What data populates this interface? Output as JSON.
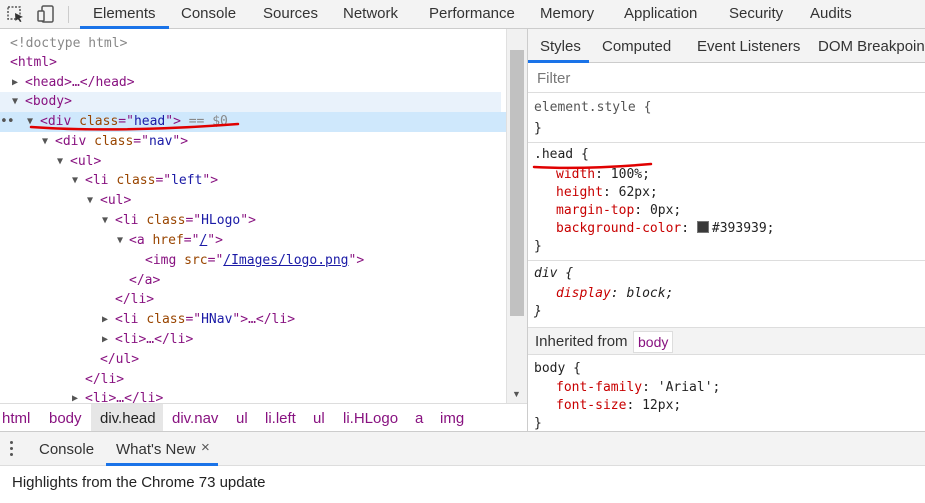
{
  "toolbar": {
    "tabs": [
      "Elements",
      "Console",
      "Sources",
      "Network",
      "Performance",
      "Memory",
      "Application",
      "Security",
      "Audits"
    ],
    "active_tab": "Elements",
    "accent_color": "#1a73e8"
  },
  "dom": {
    "doctype": "<!doctype html>",
    "html_tag": "<html>",
    "head_collapsed": "<head>…</head>",
    "body_open": "<body>",
    "selected_suffix": "== $0",
    "lines": [
      {
        "tag": "div",
        "attr": "class",
        "value": "head"
      },
      {
        "tag": "div",
        "attr": "class",
        "value": "nav"
      },
      {
        "tag": "ul"
      },
      {
        "tag": "li",
        "attr": "class",
        "value": "left"
      },
      {
        "tag": "ul"
      },
      {
        "tag": "li",
        "attr": "class",
        "value": "HLogo"
      },
      {
        "tag": "a",
        "attr": "href",
        "value": "/"
      },
      {
        "tag": "img",
        "attr": "src",
        "value": "/Images/logo.png"
      },
      {
        "close": "</a>"
      },
      {
        "close": "</li>"
      },
      {
        "tag": "li",
        "attr": "class",
        "value": "HNav",
        "collapsed": "…</li>"
      },
      {
        "collapsed_li": "<li>…</li>"
      },
      {
        "close": "</ul>"
      },
      {
        "close": "</li>"
      },
      {
        "collapsed_li": "<li>…</li>"
      }
    ]
  },
  "breadcrumb": [
    "html",
    "body",
    "div.head",
    "div.nav",
    "ul",
    "li.left",
    "ul",
    "li.HLogo",
    "a",
    "img"
  ],
  "breadcrumb_active": "div.head",
  "styles": {
    "tabs": [
      "Styles",
      "Computed",
      "Event Listeners",
      "DOM Breakpoints"
    ],
    "active_tab": "Styles",
    "filter_placeholder": "Filter",
    "rules": [
      {
        "selector": "element.style {",
        "close": "}"
      },
      {
        "selector": ".head {",
        "props": [
          {
            "name": "width",
            "value": "100%;"
          },
          {
            "name": "height",
            "value": "62px;"
          },
          {
            "name": "margin-top",
            "value": "0px;"
          },
          {
            "name": "background-color",
            "value": "#393939;"
          }
        ],
        "close": "}"
      },
      {
        "selector": "div {",
        "props": [
          {
            "name": "display",
            "value": "block;"
          }
        ],
        "close": "}"
      }
    ],
    "inherited_label": "Inherited from",
    "inherited_from": "body",
    "body_rule": {
      "selector": "body {",
      "props": [
        {
          "name": "font-family",
          "value": "'Arial';"
        },
        {
          "name": "font-size",
          "value": "12px;"
        }
      ],
      "close": "}"
    },
    "swatch_color": "#393939"
  },
  "drawer": {
    "tabs": [
      "Console",
      "What's New"
    ],
    "active_tab": "What's New",
    "close_icon": "×",
    "message": "Highlights from the Chrome 73 update"
  }
}
